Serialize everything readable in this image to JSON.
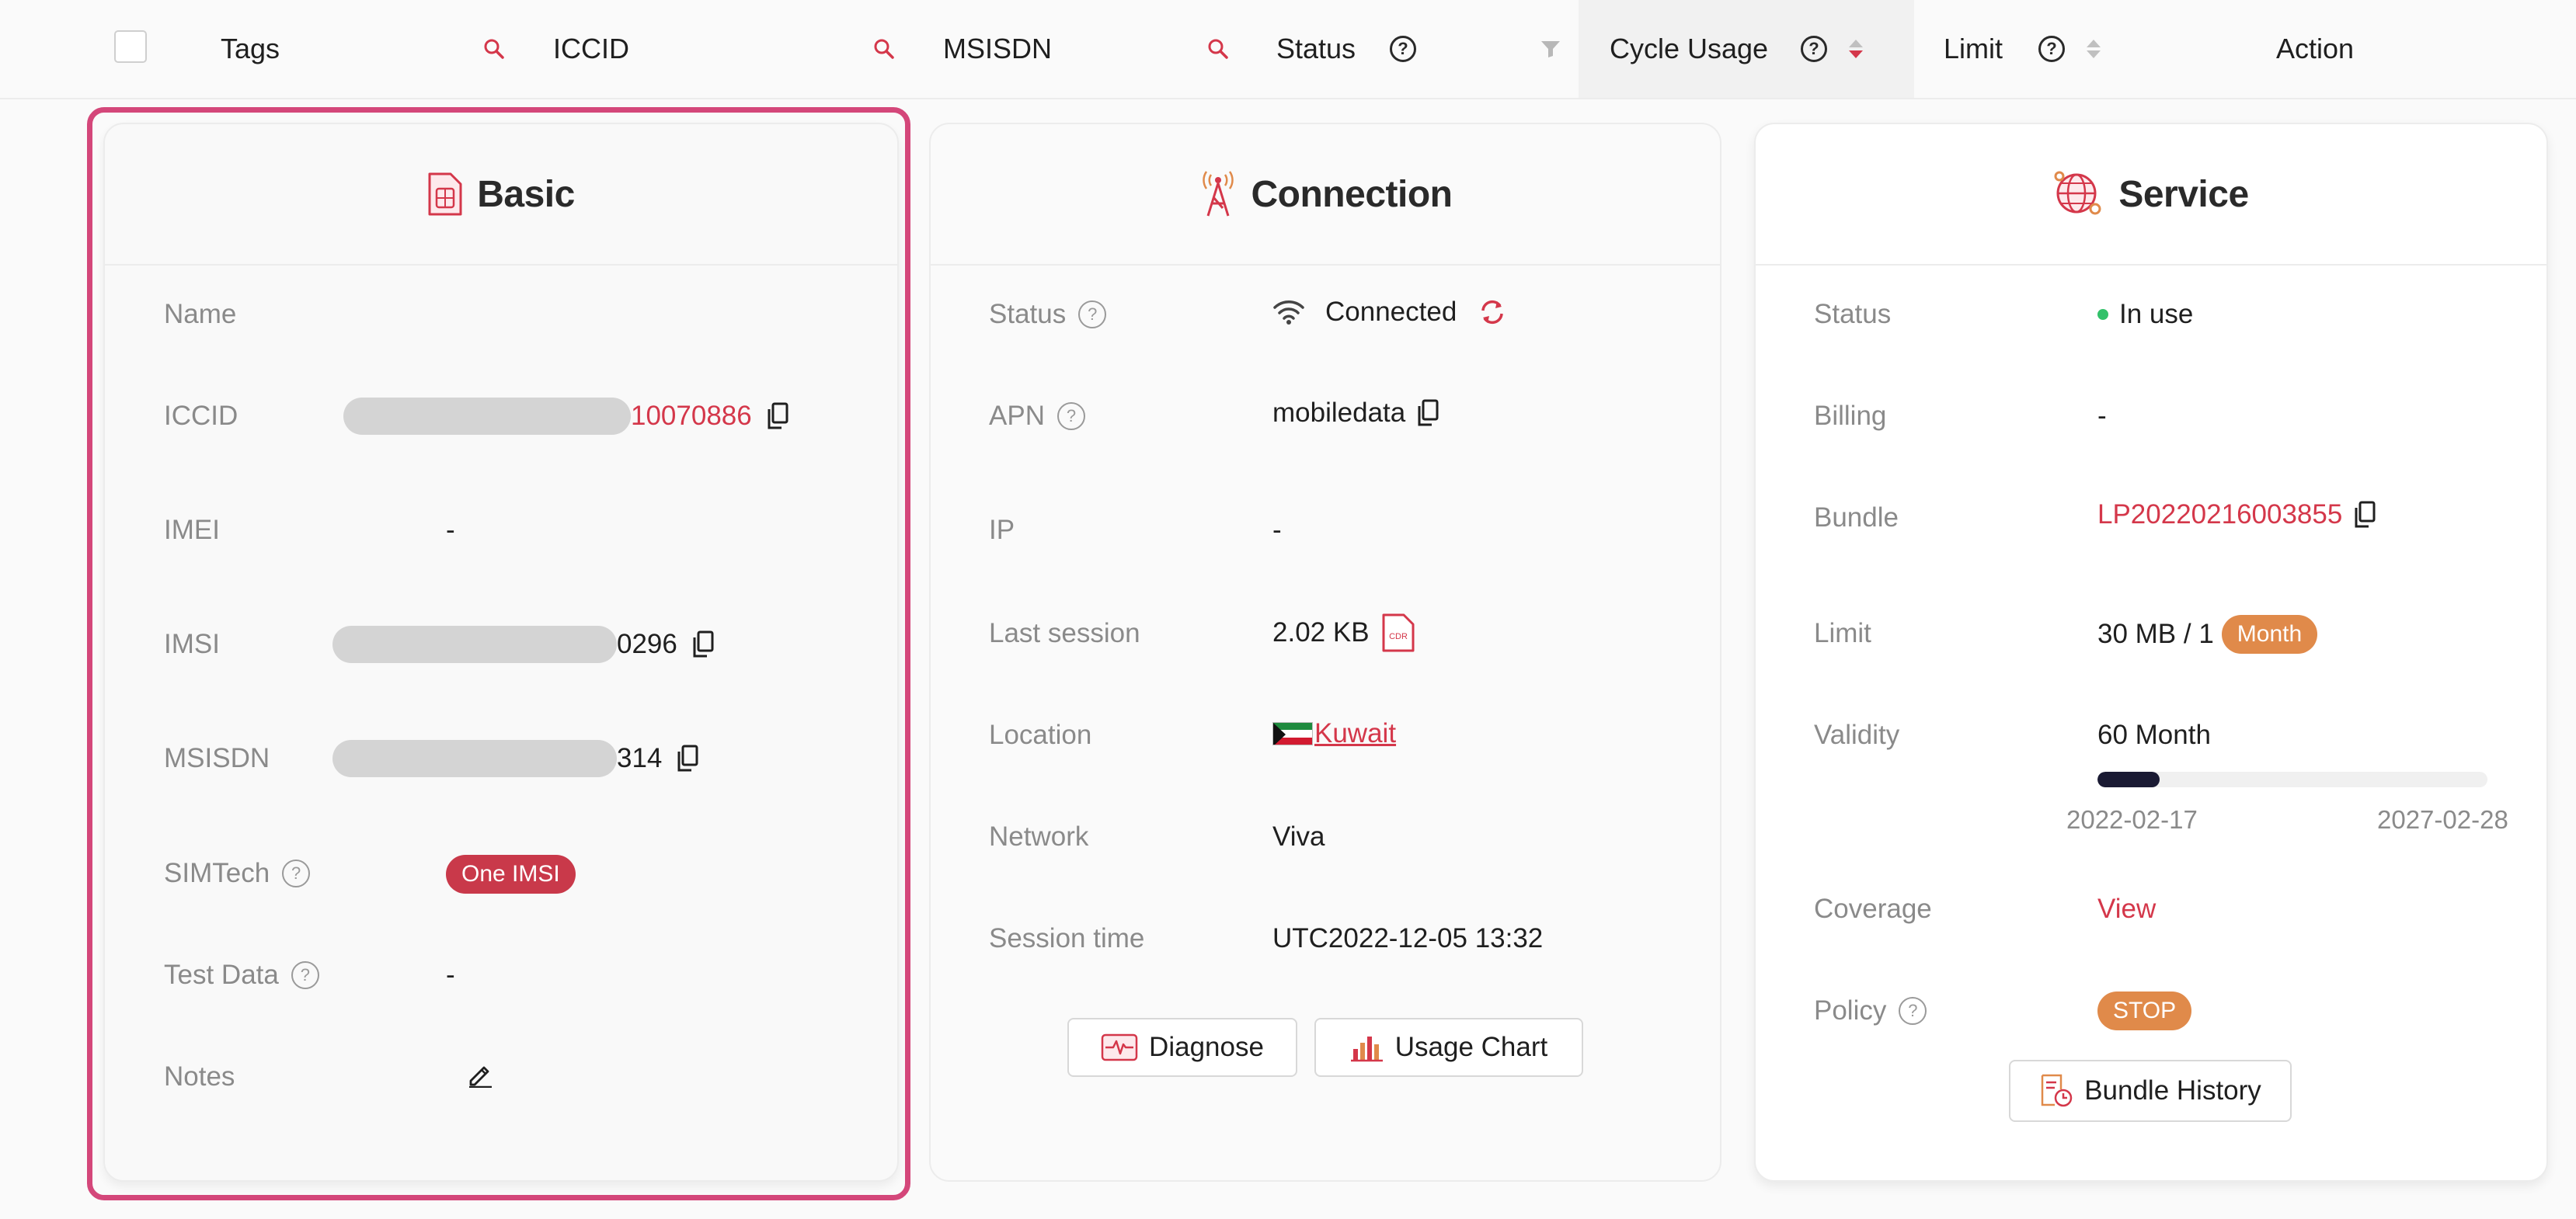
{
  "table_header": {
    "tags": "Tags",
    "iccid": "ICCID",
    "msisdn": "MSISDN",
    "status": "Status",
    "cycle_usage": "Cycle Usage",
    "limit": "Limit",
    "action": "Action",
    "help_glyph": "?"
  },
  "basic": {
    "title": "Basic",
    "fields": {
      "name_label": "Name",
      "iccid_label": "ICCID",
      "iccid_suffix": "10070886",
      "imei_label": "IMEI",
      "imei_value": "-",
      "imsi_label": "IMSI",
      "imsi_suffix": "0296",
      "msisdn_label": "MSISDN",
      "msisdn_suffix": "314",
      "simtech_label": "SIMTech",
      "simtech_badge": "One IMSI",
      "test_data_label": "Test Data",
      "test_data_value": "-",
      "notes_label": "Notes"
    }
  },
  "connection": {
    "title": "Connection",
    "fields": {
      "status_label": "Status",
      "status_value": "Connected",
      "apn_label": "APN",
      "apn_value": "mobiledata",
      "ip_label": "IP",
      "ip_value": "-",
      "last_session_label": "Last session",
      "last_session_value": "2.02 KB",
      "cdr_icon_text": "CDR",
      "location_label": "Location",
      "location_value": "Kuwait",
      "network_label": "Network",
      "network_value": "Viva",
      "session_time_label": "Session time",
      "session_time_value": "UTC2022-12-05 13:32"
    },
    "buttons": {
      "diagnose": "Diagnose",
      "usage_chart": "Usage Chart"
    }
  },
  "service": {
    "title": "Service",
    "fields": {
      "status_label": "Status",
      "status_value": "In use",
      "billing_label": "Billing",
      "billing_value": "-",
      "bundle_label": "Bundle",
      "bundle_value": "LP20220216003855",
      "limit_label": "Limit",
      "limit_value": "30 MB / 1",
      "limit_badge": "Month",
      "validity_label": "Validity",
      "validity_value": "60 Month",
      "validity_progress": 0.16,
      "validity_start": "2022-02-17",
      "validity_end": "2027-02-28",
      "coverage_label": "Coverage",
      "coverage_value": "View",
      "policy_label": "Policy",
      "policy_badge": "STOP"
    },
    "buttons": {
      "bundle_history": "Bundle History"
    }
  },
  "colors": {
    "accent_red": "#d4374a",
    "highlight_pink": "#d4477a",
    "badge_orange": "#e08a4a",
    "status_green": "#33c16a",
    "progress_fill": "#1a1a33"
  }
}
